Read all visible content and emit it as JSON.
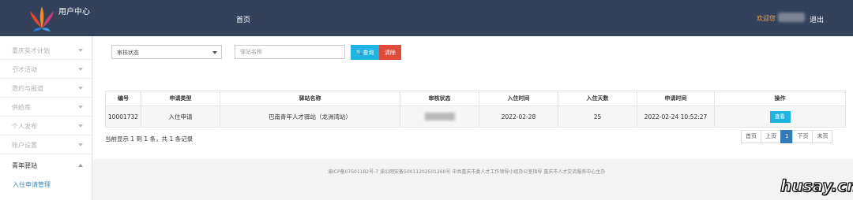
{
  "header": {
    "app_title": "用户中心",
    "nav_home": "首页",
    "welcome": "欢迎您",
    "logout": "退出"
  },
  "sidebar": {
    "items": [
      {
        "label": "重庆英才计划"
      },
      {
        "label": "引才活动"
      },
      {
        "label": "邀约与报道"
      },
      {
        "label": "供给库"
      },
      {
        "label": "个人发布"
      },
      {
        "label": "账户设置"
      },
      {
        "label": "青年驿站"
      }
    ],
    "sub_item": "入住申请管理"
  },
  "filters": {
    "status_select": "审核状态",
    "station_placeholder": "驿站名称",
    "query_label": "查询",
    "clear_label": "清除"
  },
  "table": {
    "columns": [
      "编号",
      "申请类型",
      "驿站名称",
      "审核状态",
      "入住时间",
      "入住天数",
      "申请时间",
      "操作"
    ],
    "rows": [
      {
        "id": "10001732",
        "type": "入住申请",
        "station": "巴南青年人才驿站（龙洲湾站）",
        "checkin": "2022-02-28",
        "days": "25",
        "applied": "2022-02-24 10:52:27",
        "action": "查看"
      }
    ]
  },
  "summary": "当前显示 1 到 1 条，共 1 条记录",
  "pagination": {
    "first": "首页",
    "prev": "上页",
    "current": "1",
    "next": "下页",
    "last": "末页"
  },
  "footer": "渝ICP备07501182号-7   渝公网安备50011202501260号   中共重庆市委人才工作领导小组办公室指导   重庆市人才交流服务中心主办",
  "watermark": "husay.cn",
  "colors": {
    "topbar": "#33425a",
    "welcome": "#f5a23c",
    "accent_blue": "#20b4e3",
    "danger": "#e04b3a",
    "page_active": "#337ab7"
  }
}
